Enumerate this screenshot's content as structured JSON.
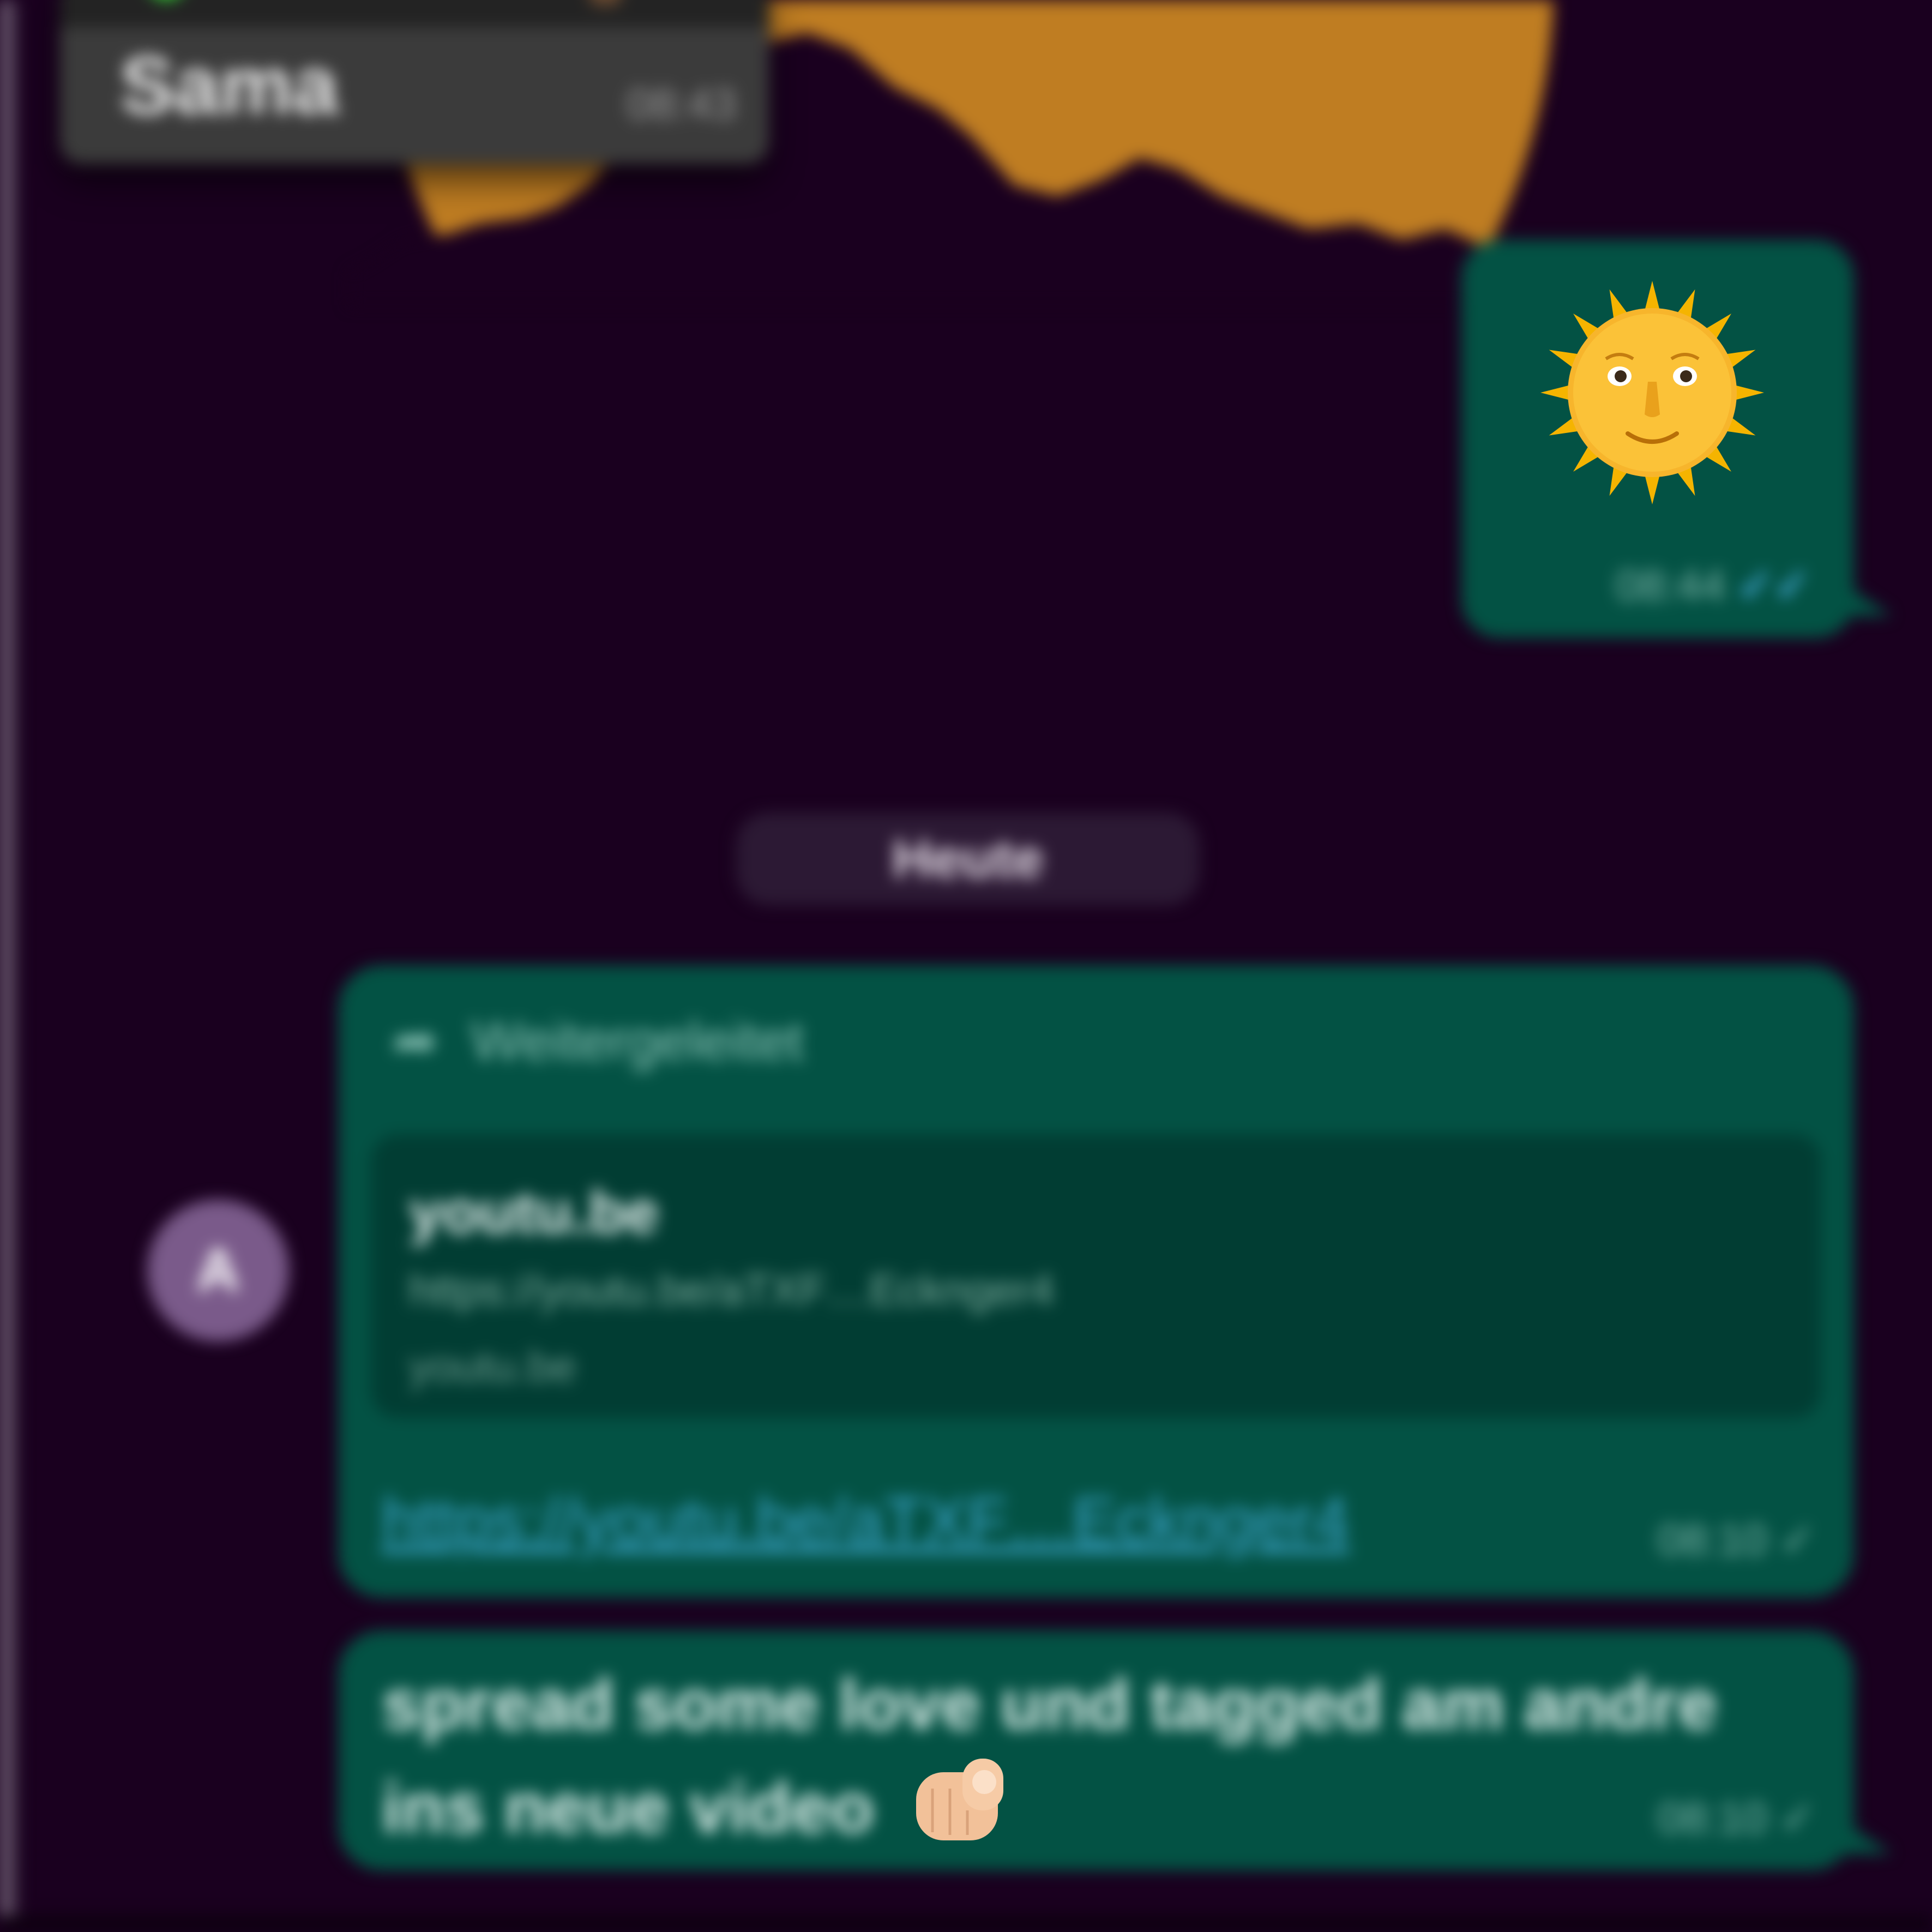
{
  "popup": {
    "sender": "Sama",
    "time": "08:43"
  },
  "sun_message": {
    "emoji_name": "sun-with-face",
    "time": "08:44",
    "status": "✓✓"
  },
  "date_chip": {
    "label": "Heute"
  },
  "avatar": {
    "initial": "A"
  },
  "forwarded_message": {
    "header": "Weitergeleitet",
    "preview_title": "youtu.be",
    "preview_description": "https://youtu.be/aTXF…Ecknger4",
    "preview_domain": "youtu.be",
    "link": "https://youtu.be/aTXF…Ecknger4",
    "time": "08:10",
    "status": "✓"
  },
  "text_message": {
    "line1": "spread some love und tagged am andre",
    "line2": "ins neue video",
    "emoji_name": "backhand-index-pointing-at-viewer",
    "time": "08:10",
    "status": "✓"
  },
  "colors": {
    "background": "#1a001f",
    "outgoing_bubble": "#035244",
    "sticker_sun": "#bf7d22",
    "link": "#3aa3c8",
    "read_check": "#4fb6ec"
  }
}
